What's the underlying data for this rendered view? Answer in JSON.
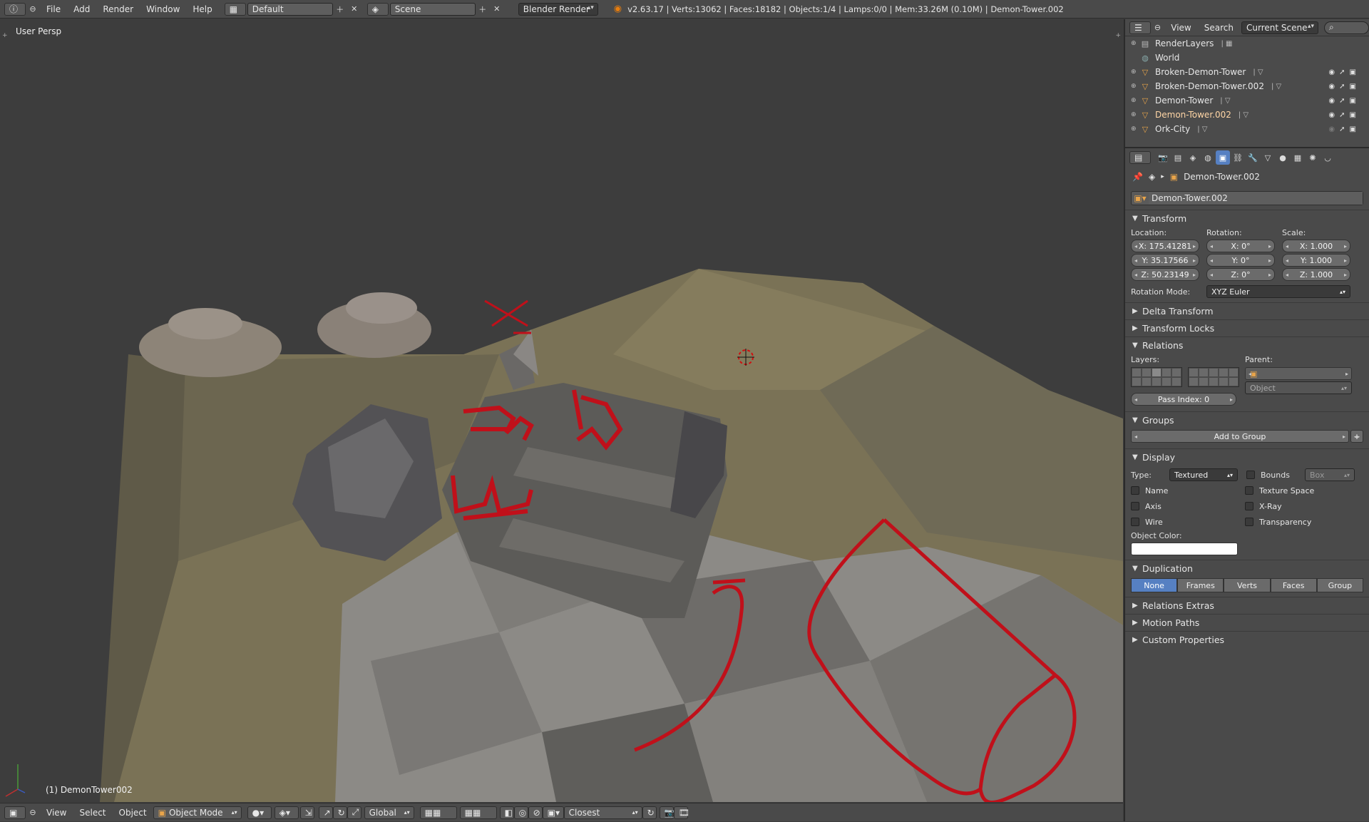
{
  "topbar": {
    "menus": [
      "File",
      "Add",
      "Render",
      "Window",
      "Help"
    ],
    "screen_layout": "Default",
    "scene": "Scene",
    "render_engine": "Blender Render",
    "stats": "v2.63.17 | Verts:13062 | Faces:18182 | Objects:1/4 | Lamps:0/0 | Mem:33.26M (0.10M) | Demon-Tower.002"
  },
  "viewport": {
    "view_label": "User Persp",
    "object_label": "(1) DemonTower002"
  },
  "bottombar": {
    "menus": [
      "View",
      "Select",
      "Object"
    ],
    "mode": "Object Mode",
    "orientation": "Global",
    "snap_target": "Closest"
  },
  "outliner": {
    "menus": [
      "View",
      "Search"
    ],
    "display": "Current Scene",
    "items": [
      {
        "name": "RenderLayers",
        "icon": "render-layers-icon"
      },
      {
        "name": "World",
        "icon": "world-icon"
      },
      {
        "name": "Broken-Demon-Tower",
        "icon": "mesh-object-icon"
      },
      {
        "name": "Broken-Demon-Tower.002",
        "icon": "mesh-object-icon"
      },
      {
        "name": "Demon-Tower",
        "icon": "mesh-object-icon"
      },
      {
        "name": "Demon-Tower.002",
        "icon": "mesh-object-icon",
        "active": true
      },
      {
        "name": "Ork-City",
        "icon": "mesh-object-icon"
      }
    ]
  },
  "properties": {
    "breadcrumb": "Demon-Tower.002",
    "object_name": "Demon-Tower.002",
    "transform": {
      "title": "Transform",
      "location_label": "Location:",
      "rotation_label": "Rotation:",
      "scale_label": "Scale:",
      "location": [
        "X: 175.41281",
        "Y: 35.17566",
        "Z: 50.23149"
      ],
      "rotation": [
        "X: 0°",
        "Y: 0°",
        "Z: 0°"
      ],
      "scale": [
        "X: 1.000",
        "Y: 1.000",
        "Z: 1.000"
      ],
      "rotation_mode_label": "Rotation Mode:",
      "rotation_mode": "XYZ Euler"
    },
    "delta_transform": "Delta Transform",
    "transform_locks": "Transform Locks",
    "relations": {
      "title": "Relations",
      "layers_label": "Layers:",
      "parent_label": "Parent:",
      "parent_type": "Object",
      "pass_index": "Pass Index: 0"
    },
    "groups": {
      "title": "Groups",
      "add_button": "Add to Group"
    },
    "display": {
      "title": "Display",
      "type_label": "Type:",
      "type_value": "Textured",
      "bounds": "Bounds",
      "bounds_type": "Box",
      "name": "Name",
      "texture_space": "Texture Space",
      "axis": "Axis",
      "xray": "X-Ray",
      "wire": "Wire",
      "transparency": "Transparency",
      "object_color_label": "Object Color:",
      "object_color": "#ffffff"
    },
    "duplication": {
      "title": "Duplication",
      "options": [
        "None",
        "Frames",
        "Verts",
        "Faces",
        "Group"
      ],
      "selected": "None"
    },
    "collapsed_panels": [
      "Relations Extras",
      "Motion Paths",
      "Custom Properties"
    ]
  },
  "colors": {
    "accent": "#5680c2",
    "annotation": "#c0101a",
    "ground": "#7a7256",
    "header": "#4a4a4a"
  }
}
